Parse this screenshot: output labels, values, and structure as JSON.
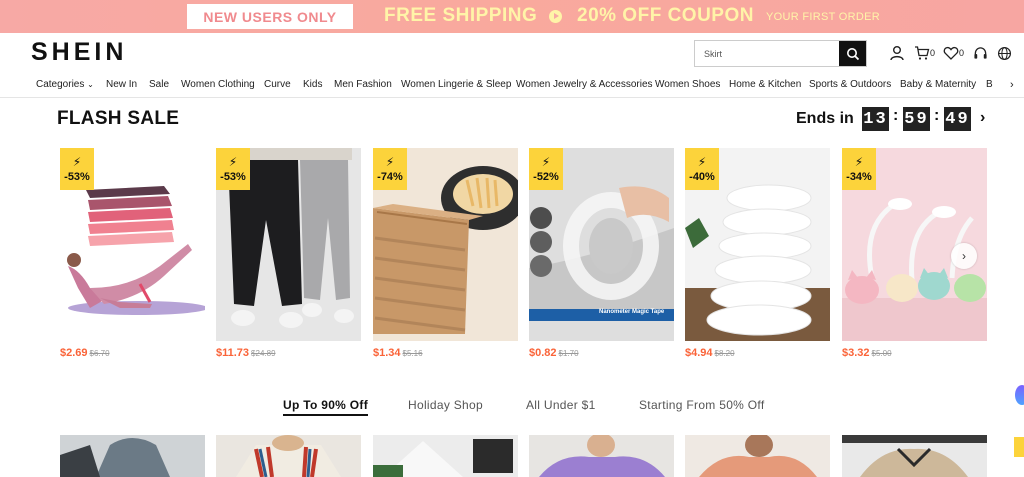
{
  "promo": {
    "new_users": "NEW USERS ONLY",
    "free_shipping": "FREE SHIPPING",
    "coupon": "20% OFF COUPON",
    "first_order": "YOUR FIRST ORDER"
  },
  "header": {
    "logo": "SHEIN",
    "search_value": "Skirt",
    "cart_count": "0",
    "wishlist_count": "0"
  },
  "nav": {
    "items": [
      "Categories",
      "New In",
      "Sale",
      "Women Clothing",
      "Curve",
      "Kids",
      "Men Fashion",
      "Women Lingerie & Sleep",
      "Women Jewelry & Accessories",
      "Women Shoes",
      "Home & Kitchen",
      "Sports & Outdoors",
      "Baby & Maternity",
      "B"
    ]
  },
  "flash_sale": {
    "title": "FLASH SALE",
    "ends_label": "Ends in",
    "hours": "13",
    "minutes": "59",
    "seconds": "49",
    "products": [
      {
        "discount": "-53%",
        "price": "$2.69",
        "old_price": "$6.70",
        "image": "resistance-bands"
      },
      {
        "discount": "-53%",
        "price": "$11.73",
        "old_price": "$24.89",
        "image": "men-joggers"
      },
      {
        "discount": "-74%",
        "price": "$1.34",
        "old_price": "$5.16",
        "image": "air-fryer-liners"
      },
      {
        "discount": "-52%",
        "price": "$0.82",
        "old_price": "$1.70",
        "image": "nano-tape",
        "caption": "Nanometer Magic Tape"
      },
      {
        "discount": "-40%",
        "price": "$4.94",
        "old_price": "$8.20",
        "image": "pillow-inserts"
      },
      {
        "discount": "-34%",
        "price": "$3.32",
        "old_price": "$5.00",
        "image": "cat-desk-lamps"
      }
    ]
  },
  "tabs": [
    "Up To 90% Off",
    "Holiday Shop",
    "All Under $1",
    "Starting From 50% Off"
  ],
  "colors": {
    "accent_price": "#fa6338",
    "badge": "#fcd33b",
    "promo_bg": "#f7a9a5",
    "promo_text": "#fff4a8"
  }
}
